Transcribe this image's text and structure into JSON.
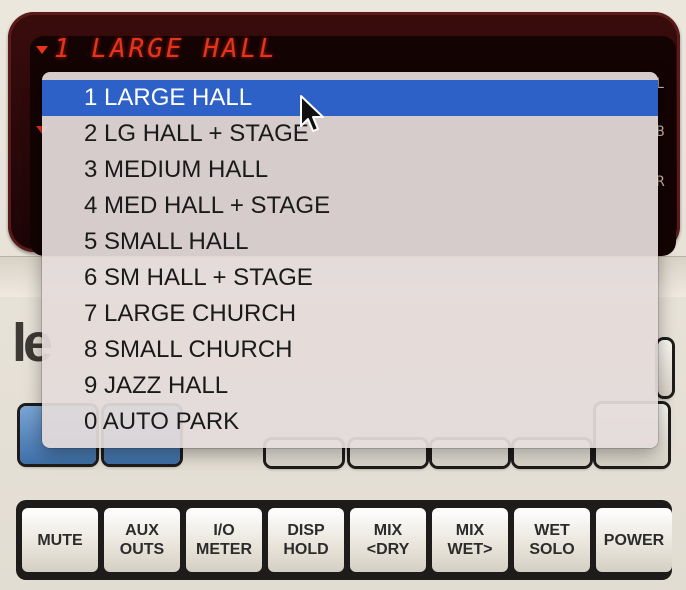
{
  "display": {
    "preset_text": "1 LARGE HALL",
    "side_letters": [
      "L",
      "B",
      "R"
    ]
  },
  "logo": {
    "fragment": "le"
  },
  "preset_menu": {
    "items": [
      "1 LARGE HALL",
      "2 LG HALL + STAGE",
      "3 MEDIUM HALL",
      "4 MED HALL + STAGE",
      "5 SMALL HALL",
      "6 SM HALL + STAGE",
      "7 LARGE CHURCH",
      "8 SMALL CHURCH",
      "9 JAZZ HALL",
      "0 AUTO PARK"
    ],
    "selected_index": 0
  },
  "buttons": [
    {
      "label": "MUTE"
    },
    {
      "label": "AUX\nOUTS"
    },
    {
      "label": "I/O\nMETER"
    },
    {
      "label": "DISP\nHOLD"
    },
    {
      "label": "MIX\n<DRY"
    },
    {
      "label": "MIX\nWET>"
    },
    {
      "label": "WET\nSOLO"
    },
    {
      "label": "POWER"
    }
  ],
  "colors": {
    "led": "#e8321c",
    "selection": "#2e61c8",
    "menu_bg": "#e4dcda"
  }
}
